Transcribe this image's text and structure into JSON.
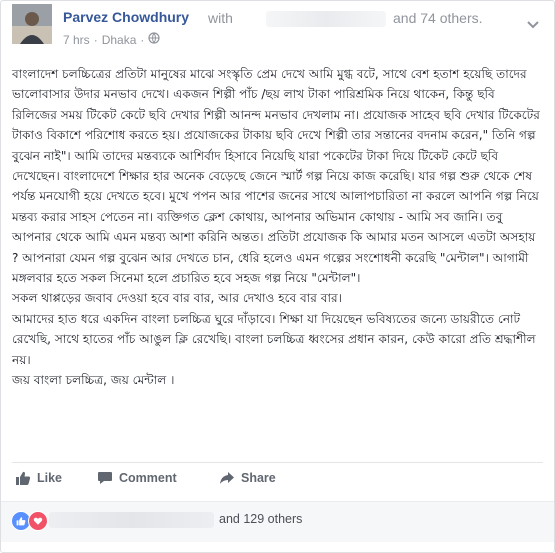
{
  "post": {
    "author": "Parvez Chowdhury",
    "with_text": "with",
    "others_text": "and 74 others.",
    "time": "7 hrs",
    "separator": "·",
    "location": "Dhaka",
    "separator2": "·",
    "body": "বাংলাদেশ চলচ্চিত্রের প্রতিটা মানুষের মাঝে সংস্কৃতি প্রেম দেখে আমি মুগ্ধ বটে, সাথে বেশ হতাশ হয়েছি তাদের ভালোবাসার উদার মনভাব দেখে। একজন শিল্পী পাঁচ /ছয় লাখ টাকা পারিশ্রমিক নিয়ে থাকেন, কিন্তু ছবি রিলিজের সময় টিকেট কেটে ছবি দেখার শিল্পী আনন্দ মনভাব দেখলাম না। প্রযোজক সাহেব ছবি দেখার টিকেটের টাকাও বিকাশে পরিশোধ করতে হয়। প্রযোজকের টাকায় ছবি দেখে শিল্পী তার সন্তানের বদনাম করেন,\" তিনি গল্প বুঝেন নাই\"। আমি তাদের মন্তব্যকে আশির্বাদ হিসাবে নিয়েছি যারা পকেটের টাকা দিয়ে টিকেট কেটে ছবি দেখেছেন। বাংলাদেশে শিক্ষার হার অনেক বেড়েছে জেনে স্মার্ট গল্প নিয়ে কাজ করেছি। যার গল্প শুরু থেকে শেষ পর্যন্ত মনযোগী হয়ে দেখতে হবে। মুখে পপন আর পাশের জনের সাথে আলাপচারিতা না করলে আপনি গল্প নিয়ে মন্তব্য করার সাহস পেতেন না। ব্যক্তিগত ক্লেশ কোথায়, আপনার অভিমান কোথায় - আমি সব জানি। তবু আপনার থেকে আমি এমন মন্তব্য আশা করিনি অন্তত। প্রতিটা প্রযোজক কি আমার মতন আসলে এতটা অসহায় ? আপনারা যেমন গল্প বুঝেন আর দেখতে চান, ধেরি হলেও এমন গল্পের সংশোধনী করেছি \"মেন্টাল\"। আগামী মঙ্গলবার হতে সকল সিনেমা হলে প্রচারিত হবে সহজ গল্প নিয়ে \"মেন্টাল\"।\nসকল থাপ্পড়ের জবাব দেওয়া হবে বার বার, আর দেখাও হবে বার বার।\nআমাদের হাত ধরে একদিন বাংলা চলচ্চিত্র ঘুরে দাঁড়াবে। শিক্ষা যা দিয়েছেন ভবিষ্যতের জন্যে ডায়রীতে নোট রেখেছি, সাথে হাতের পাঁচ আঙুল ক্লি রেখেছি। বাংলা চলচ্চিত্র ধ্বংসের প্রধান কারন, কেউ কারো প্রতি শ্রদ্ধাশীল নয়।\nজয় বাংলা চলচ্চিত্র, জয় মেন্টাল ।"
  },
  "actions": {
    "like_label": "Like",
    "comment_label": "Comment",
    "share_label": "Share"
  },
  "reactions": {
    "icons": [
      "like-icon",
      "love-icon"
    ],
    "count_text": "and 129 others"
  },
  "colors": {
    "link": "#365899",
    "muted": "#90949c",
    "like": "#5890ff",
    "love": "#f25268"
  }
}
